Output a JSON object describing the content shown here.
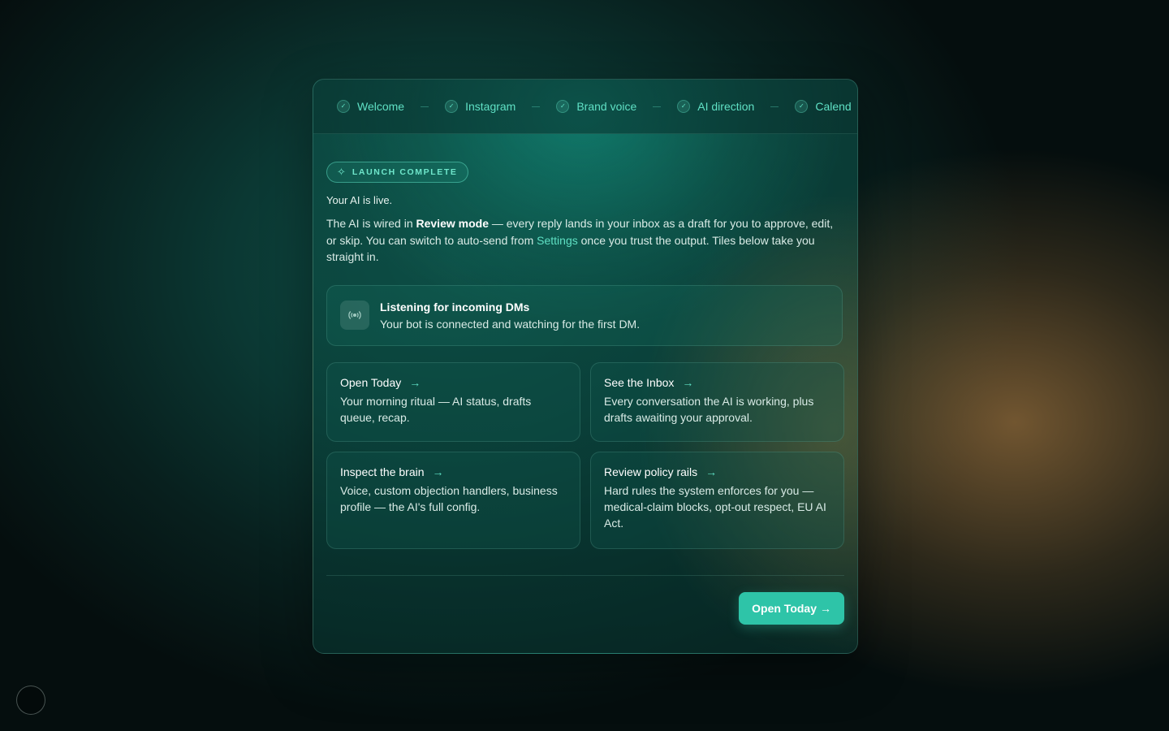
{
  "steps": [
    {
      "label": "Welcome"
    },
    {
      "label": "Instagram"
    },
    {
      "label": "Brand voice"
    },
    {
      "label": "AI direction"
    },
    {
      "label": "Calend"
    }
  ],
  "badge": {
    "label": "LAUNCH COMPLETE",
    "icon": "sparkle-icon"
  },
  "headline": "Your AI is live.",
  "intro": {
    "part1": "The AI is wired in ",
    "mode": "Review mode",
    "part2": " — every reply lands in your inbox as a draft for you to approve, edit, or skip. You can switch to auto-send from ",
    "settings_link": "Settings",
    "part3": " once you trust the output. Tiles below take you straight in."
  },
  "listening": {
    "icon": "broadcast-icon",
    "title": "Listening for incoming DMs",
    "subtitle": "Your bot is connected and watching for the first DM."
  },
  "tiles": [
    {
      "title": "Open Today",
      "desc": "Your morning ritual — AI status, drafts queue, recap."
    },
    {
      "title": "See the Inbox",
      "desc": "Every conversation the AI is working, plus drafts awaiting your approval."
    },
    {
      "title": "Inspect the brain",
      "desc": "Voice, custom objection handlers, business profile — the AI's full config."
    },
    {
      "title": "Review policy rails",
      "desc": "Hard rules the system enforces for you — medical-claim blocks, opt-out respect, EU AI Act."
    }
  ],
  "cta": {
    "label": "Open Today",
    "arrow": "→"
  },
  "colors": {
    "accent": "#5fe0c4",
    "button": "#2ec4a8"
  }
}
